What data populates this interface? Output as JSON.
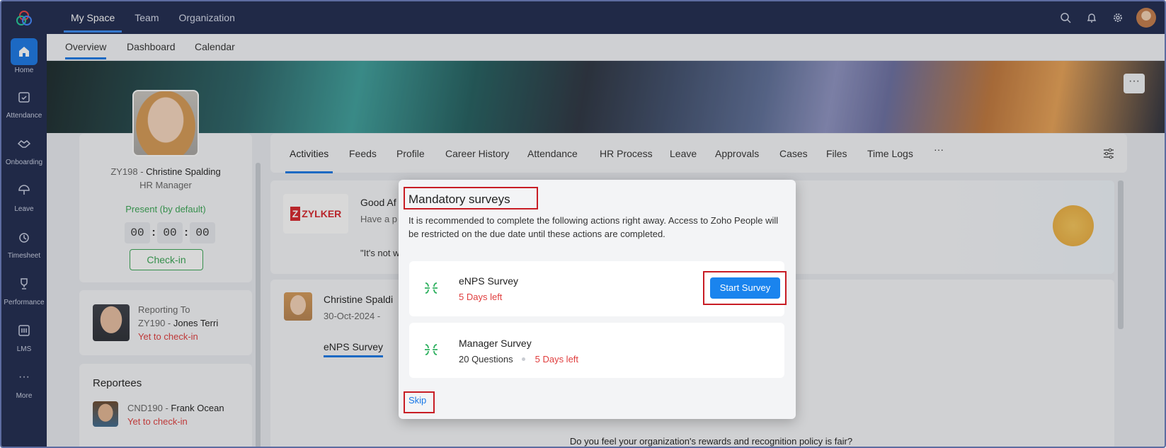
{
  "topnav": {
    "tabs": [
      {
        "label": "My Space",
        "active": true
      },
      {
        "label": "Team",
        "active": false
      },
      {
        "label": "Organization",
        "active": false
      }
    ]
  },
  "subnav": {
    "tabs": [
      {
        "label": "Overview",
        "active": true
      },
      {
        "label": "Dashboard",
        "active": false
      },
      {
        "label": "Calendar",
        "active": false
      }
    ]
  },
  "sidebar": {
    "items": [
      {
        "label": "Home",
        "icon": "home-icon",
        "active": true
      },
      {
        "label": "Attendance",
        "icon": "attendance-icon"
      },
      {
        "label": "Onboarding",
        "icon": "handshake-icon"
      },
      {
        "label": "Leave",
        "icon": "umbrella-icon"
      },
      {
        "label": "Timesheet",
        "icon": "timesheet-icon"
      },
      {
        "label": "Performance",
        "icon": "trophy-icon"
      },
      {
        "label": "LMS",
        "icon": "lms-icon"
      },
      {
        "label": "More",
        "icon": "more-icon"
      }
    ]
  },
  "profile": {
    "id": "ZY198 - ",
    "name": "Christine Spalding",
    "role": "HR Manager",
    "status": "Present (by default)",
    "timer": [
      "00",
      "00",
      "00"
    ],
    "checkin_label": "Check-in"
  },
  "reporting": {
    "title": "Reporting To",
    "id": "ZY190 - ",
    "name": "Jones Terri",
    "status": "Yet to check-in"
  },
  "reportees": {
    "title": "Reportees",
    "items": [
      {
        "id": "CND190 - ",
        "name": "Frank Ocean",
        "status": "Yet to check-in"
      }
    ]
  },
  "main_tabs": [
    "Activities",
    "Feeds",
    "Profile",
    "Career History",
    "Attendance",
    "HR Process",
    "Leave",
    "Approvals",
    "Cases",
    "Files",
    "Time Logs",
    "···"
  ],
  "activity": {
    "company_logo": "ZYLKER",
    "greeting": "Good Af",
    "sub": "Have a p",
    "quote": "\"It's not w",
    "post_author": "Christine Spaldi",
    "post_date": "30-Oct-2024  -",
    "post_title": "eNPS Survey",
    "question": "Do you feel your organization's rewards and recognition policy is fair?"
  },
  "modal": {
    "title": "Mandatory surveys",
    "description": "It is recommended to complete the following actions right away. Access to Zoho People will be restricted on the due date until these actions are completed.",
    "surveys": [
      {
        "name": "eNPS Survey",
        "due": "5 Days left",
        "action": "Start Survey"
      },
      {
        "name": "Manager Survey",
        "questions": "20 Questions",
        "due": "5 Days left"
      }
    ],
    "skip_label": "Skip"
  },
  "colors": {
    "nav_bg": "#1f2a4f",
    "accent": "#1a78e6",
    "highlight": "#c81d25",
    "danger": "#e03e3e",
    "success": "#3aa655"
  }
}
